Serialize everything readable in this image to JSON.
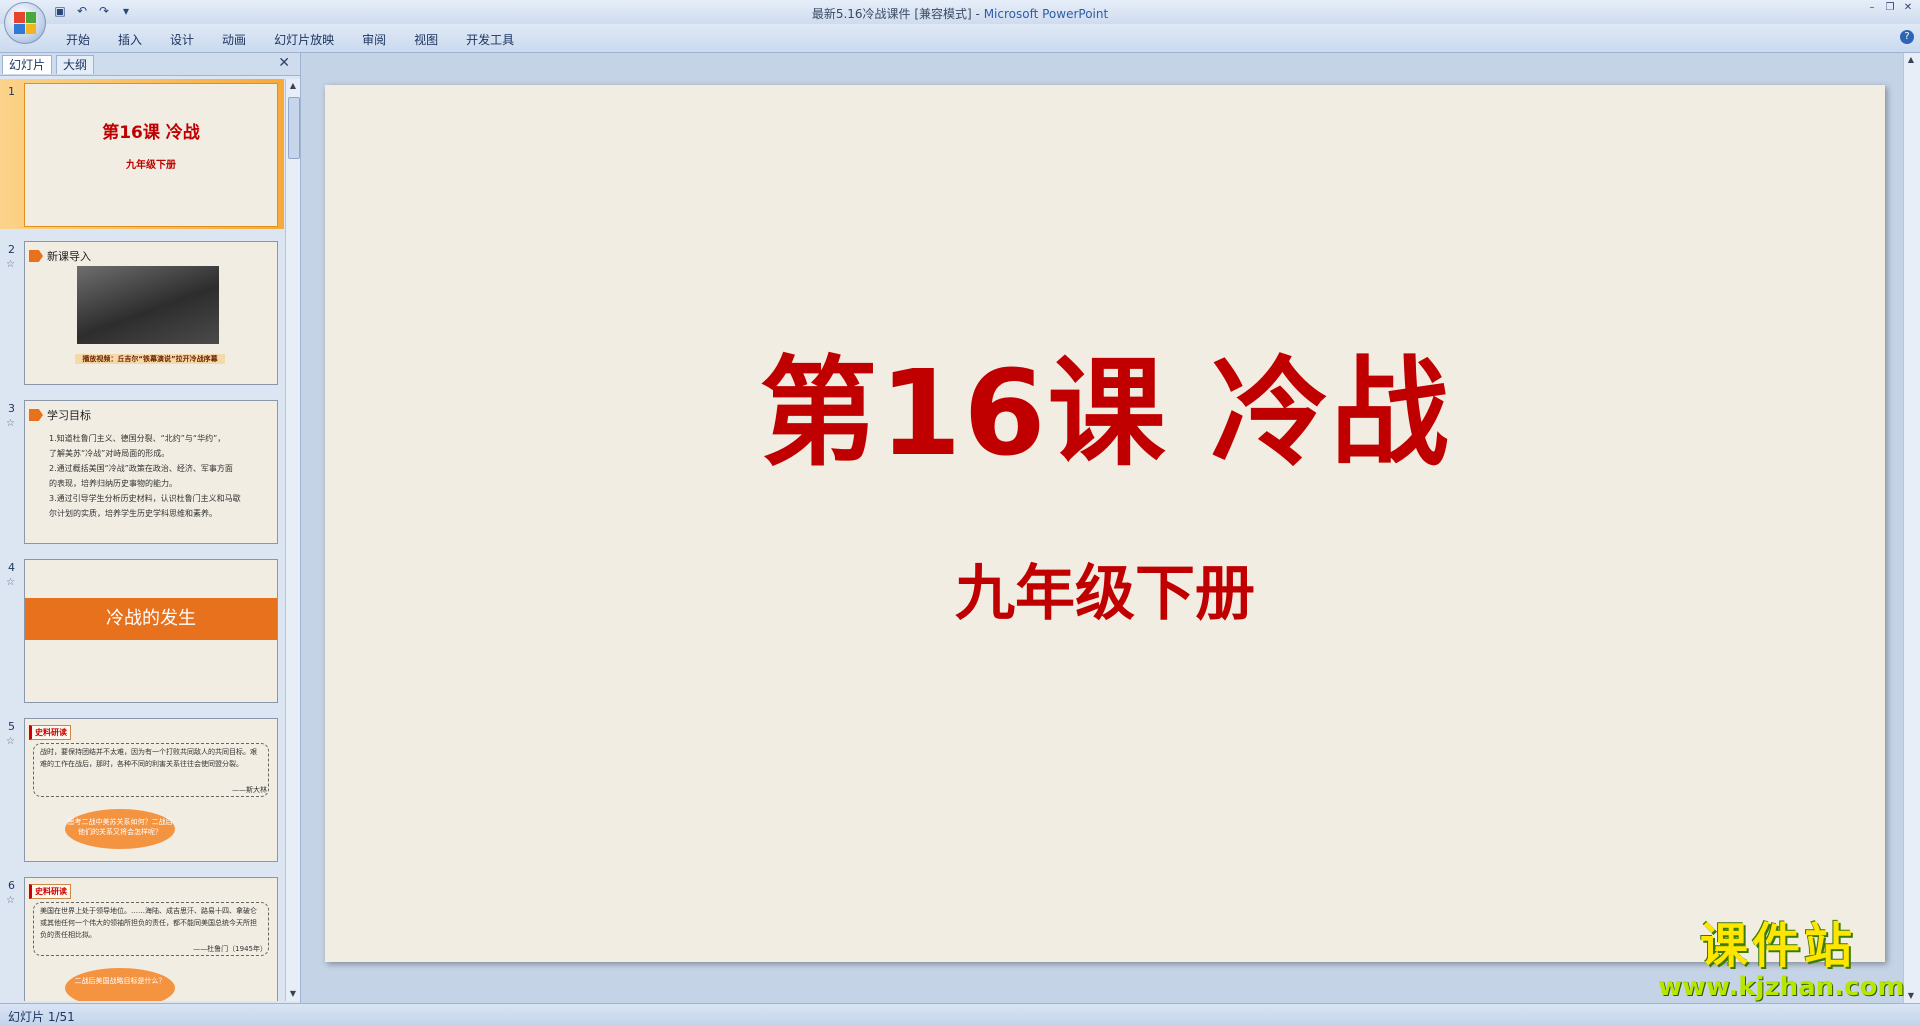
{
  "window": {
    "title": "最新5.16冷战课件 [兼容模式]",
    "separator": " - ",
    "app_name": "Microsoft PowerPoint"
  },
  "quick_access": {
    "icons": [
      "save-icon",
      "undo-icon",
      "redo-icon",
      "customize-icon"
    ]
  },
  "ribbon": {
    "tabs": [
      "开始",
      "插入",
      "设计",
      "动画",
      "幻灯片放映",
      "审阅",
      "视图",
      "开发工具"
    ]
  },
  "panel": {
    "tab_slides": "幻灯片",
    "tab_outline": "大纲",
    "close_glyph": "✕"
  },
  "thumbnails": [
    {
      "num": "1",
      "title": "第16课 冷战",
      "subtitle": "九年级下册"
    },
    {
      "num": "2",
      "heading": "新课导入",
      "caption": "播放视频：丘吉尔“铁幕演说”拉开冷战序幕"
    },
    {
      "num": "3",
      "heading": "学习目标",
      "lines": [
        "1.知道杜鲁门主义、德国分裂、“北约”与“华约”，",
        "了解美苏“冷战”对峙局面的形成。",
        "2.通过概括美国“冷战”政策在政治、经济、军事方面",
        "的表现，培养归纳历史事物的能力。",
        "3.通过引导学生分析历史材料，认识杜鲁门主义和马歇",
        "尔计划的实质，培养学生历史学科思维和素养。"
      ]
    },
    {
      "num": "4",
      "banner": "冷战的发生"
    },
    {
      "num": "5",
      "tag": "史料研读",
      "text": "战时，要保持团结并不太难，因为有一个打败共同敌人的共同目标。艰难的工作在战后，那时，各种不同的利害关系往往会使同盟分裂。",
      "author": "——斯大林",
      "cloud": "思考二战中美苏关系如何？二战后他们的关系又将会怎样呢？"
    },
    {
      "num": "6",
      "tag": "史料研读",
      "text": "美国在世界上处于领导地位。……海陆、成吉思汗、路易十四、拿破仑或其他任何一个伟大的领袖所担负的责任，都不能同美国总统今天所担负的责任相比拟。",
      "author": "——杜鲁门（1945年）",
      "cloud": "二战后美国战略目标是什么？"
    }
  ],
  "main_slide": {
    "title": "第16课 冷战",
    "subtitle": "九年级下册"
  },
  "watermark": {
    "main": "课件站",
    "url": "www.kjzhan.com"
  },
  "status": {
    "slide_info": "幻灯片 1/51"
  }
}
